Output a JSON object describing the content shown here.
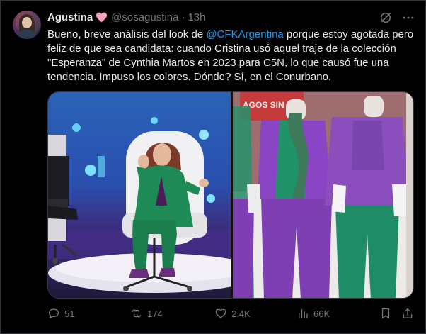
{
  "tweet": {
    "author_name": "Agustina",
    "handle": "@sosagustina",
    "separator": "·",
    "time": "13h",
    "text_before": "Bueno, breve análisis del look de ",
    "mention": "@CFKArgentina",
    "text_after": " porque estoy agotada pero feliz de que sea candidata: cuando Cristina usó aquel traje de la colección \"Esperanza\" de Cynthia Martos en 2023 para C5N, lo que causó fue una tendencia. Impuso los colores. Dónde? Sí, en el Conurbano.",
    "sign_text": "AGOS SIN R"
  },
  "metrics": {
    "replies": "51",
    "reposts": "174",
    "likes": "2.4K",
    "views": "66K"
  },
  "icons": {
    "verified": "heart-icon",
    "grok": "grok-icon",
    "more": "more-icon",
    "reply": "reply-icon",
    "repost": "repost-icon",
    "like": "like-icon",
    "views": "views-icon",
    "bookmark": "bookmark-icon",
    "share": "share-icon"
  },
  "colors": {
    "accent": "#1d9bf0",
    "heart": "#f7a1c4",
    "muted": "#71767b",
    "text": "#e7e9ea"
  }
}
